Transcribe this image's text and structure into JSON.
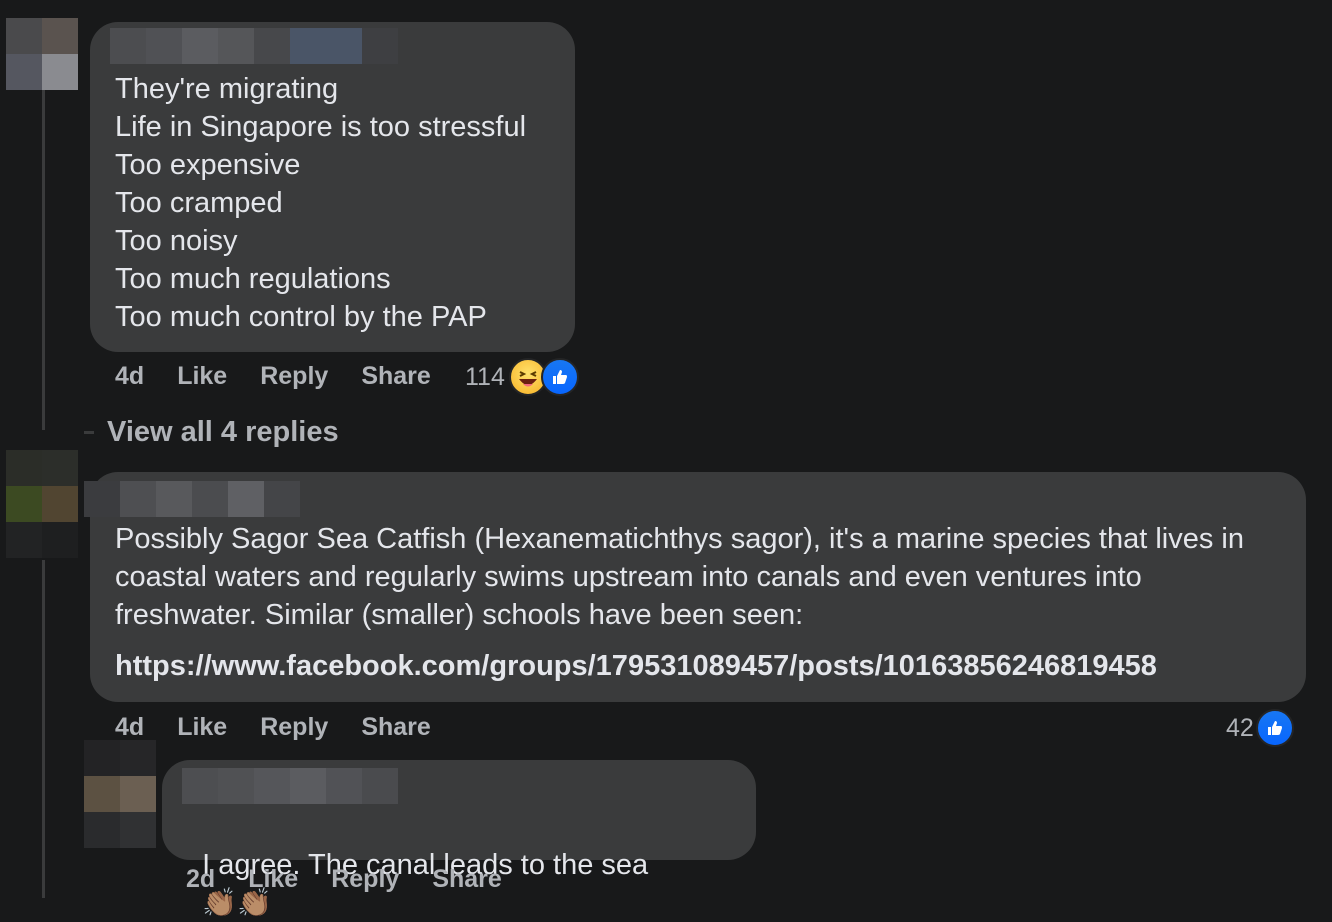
{
  "comments": [
    {
      "lines": [
        "They're migrating",
        "Life in Singapore is too stressful",
        "Too expensive",
        "Too cramped",
        "Too noisy",
        "Too much regulations",
        "Too much control by the PAP"
      ],
      "time": "4d",
      "like_label": "Like",
      "reply_label": "Reply",
      "share_label": "Share",
      "reaction_count": "114",
      "reactions": [
        "haha-icon",
        "like-icon"
      ]
    },
    {
      "text": "Possibly Sagor Sea Catfish (Hexanematichthys sagor), it's a marine species that lives in coastal waters and regularly swims upstream into canals and even ventures into freshwater. Similar (smaller) schools have been seen:",
      "link": "https://www.facebook.com/groups/179531089457/posts/10163856246819458",
      "time": "4d",
      "like_label": "Like",
      "reply_label": "Reply",
      "share_label": "Share",
      "reaction_count": "42",
      "reactions": [
        "like-icon"
      ]
    },
    {
      "text": "I agree. The canal leads to the sea",
      "emoji": "👏🏽👏🏽",
      "time": "2d",
      "like_label": "Like",
      "reply_label": "Reply",
      "share_label": "Share"
    }
  ],
  "view_replies_label": "View all 4 replies",
  "colors": {
    "background": "#18191a",
    "bubble": "#3a3b3c",
    "secondary_text": "#b0b3b8",
    "like_blue": "#1877f2"
  }
}
